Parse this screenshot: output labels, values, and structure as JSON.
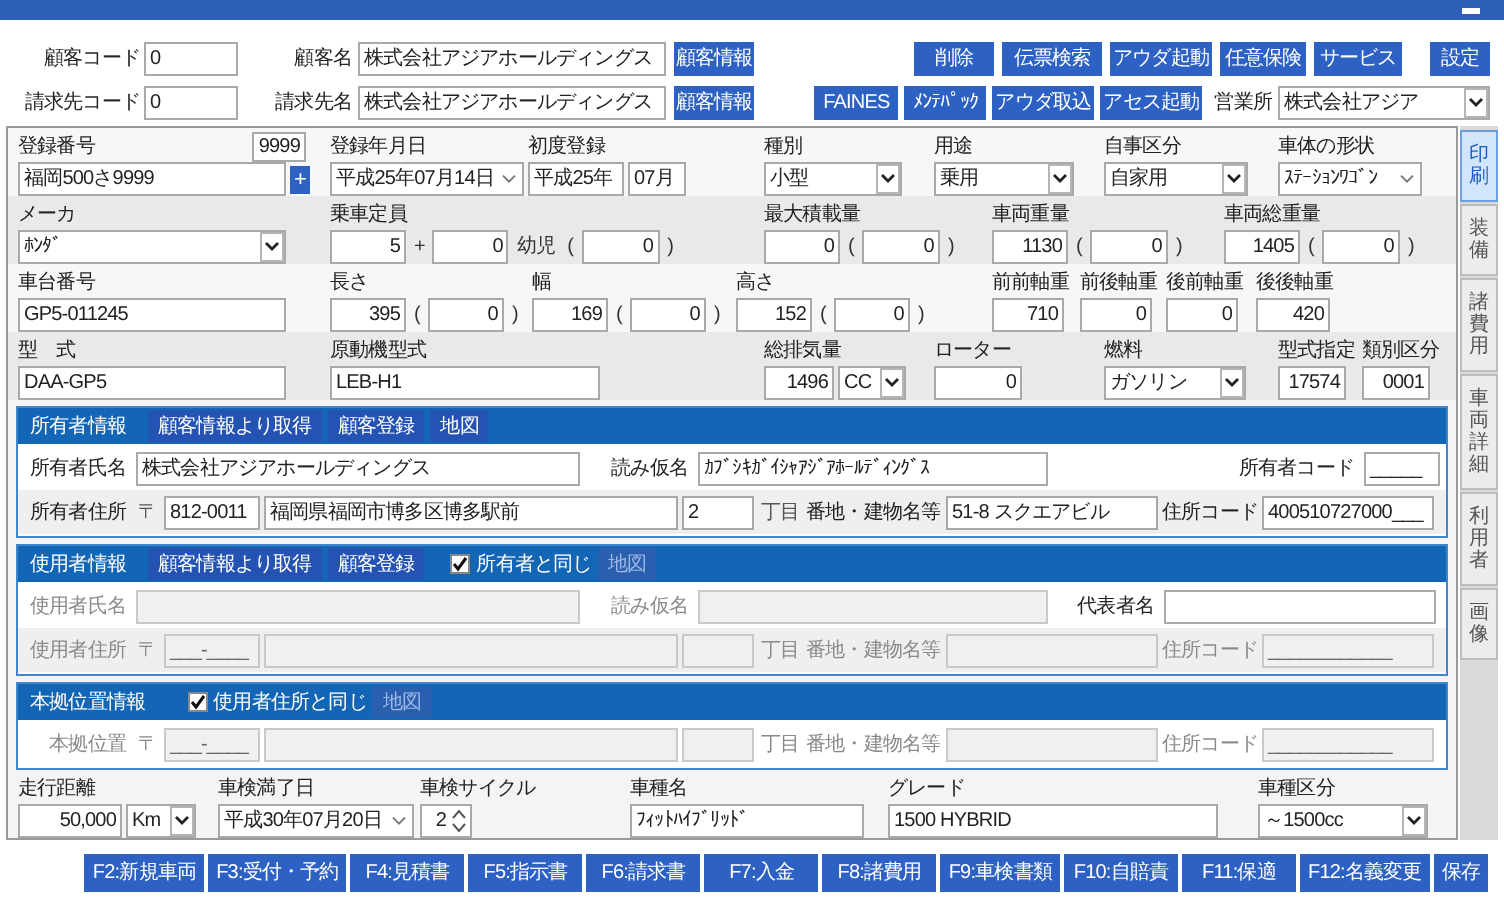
{
  "customer": {
    "rows": [
      {
        "code_label": "顧客コード",
        "code": "0",
        "name_label": "顧客名",
        "name": "株式会社アジアホールディングス",
        "info_button": "顧客情報"
      },
      {
        "code_label": "請求先コード",
        "code": "0",
        "name_label": "請求先名",
        "name": "株式会社アジアホールディングス",
        "info_button": "顧客情報"
      }
    ]
  },
  "toolbar": {
    "row1": [
      "削除",
      "伝票検索",
      "アウダ起動",
      "任意保険",
      "サービス",
      "設定"
    ],
    "row2": [
      "FAINES",
      "ﾒﾝﾃﾊﾟｯｸ",
      "アウダ取込",
      "アセス起動"
    ],
    "office_label": "営業所",
    "office": "株式会社アジア"
  },
  "vehicle": {
    "rows": [
      {
        "fields": [
          {
            "label": "登録番号",
            "number": "9999",
            "controls": [
              {
                "kind": "input",
                "value": "福岡500さ9999"
              },
              {
                "kind": "add_button",
                "value": "+"
              }
            ]
          },
          {
            "label": "登録年月日",
            "controls": [
              {
                "kind": "picker",
                "value": "平成25年07月14日"
              }
            ]
          },
          {
            "label": "初度登録",
            "controls": [
              {
                "kind": "input",
                "value": "平成25年"
              },
              {
                "kind": "input",
                "value": "07月"
              }
            ]
          },
          {
            "label": "種別",
            "controls": [
              {
                "kind": "select",
                "value": "小型"
              }
            ]
          },
          {
            "label": "用途",
            "controls": [
              {
                "kind": "select",
                "value": "乗用"
              }
            ]
          },
          {
            "label": "自事区分",
            "controls": [
              {
                "kind": "select",
                "value": "自家用"
              }
            ]
          },
          {
            "label": "車体の形状",
            "controls": [
              {
                "kind": "picker",
                "value": "ｽﾃｰｼｮﾝﾜｺﾞﾝ"
              }
            ]
          }
        ]
      },
      {
        "fields": [
          {
            "label": "メーカ",
            "controls": [
              {
                "kind": "select",
                "value": "ﾎﾝﾀﾞ"
              }
            ]
          },
          {
            "label": "乗車定員",
            "controls": [
              {
                "kind": "number",
                "value": "5"
              },
              {
                "kind": "text",
                "value": "+"
              },
              {
                "kind": "number",
                "value": "0"
              },
              {
                "kind": "text",
                "value": "幼児"
              },
              {
                "kind": "text",
                "value": "("
              },
              {
                "kind": "number",
                "value": "0"
              },
              {
                "kind": "text",
                "value": ")"
              }
            ]
          },
          {
            "label": "最大積載量",
            "controls": [
              {
                "kind": "number",
                "value": "0"
              },
              {
                "kind": "text",
                "value": "("
              },
              {
                "kind": "number",
                "value": "0"
              },
              {
                "kind": "text",
                "value": ")"
              }
            ]
          },
          {
            "label": "車両重量",
            "controls": [
              {
                "kind": "number",
                "value": "1130"
              },
              {
                "kind": "text",
                "value": "("
              },
              {
                "kind": "number",
                "value": "0"
              },
              {
                "kind": "text",
                "value": ")"
              }
            ]
          },
          {
            "label": "車両総重量",
            "controls": [
              {
                "kind": "number",
                "value": "1405"
              },
              {
                "kind": "text",
                "value": "("
              },
              {
                "kind": "number",
                "value": "0"
              },
              {
                "kind": "text",
                "value": ")"
              }
            ]
          }
        ]
      },
      {
        "fields": [
          {
            "label": "車台番号",
            "controls": [
              {
                "kind": "input",
                "value": "GP5-011245"
              }
            ]
          },
          {
            "label": "長さ",
            "controls": [
              {
                "kind": "number",
                "value": "395"
              },
              {
                "kind": "text",
                "value": "("
              },
              {
                "kind": "number",
                "value": "0"
              },
              {
                "kind": "text",
                "value": ")"
              }
            ]
          },
          {
            "label": "幅",
            "controls": [
              {
                "kind": "number",
                "value": "169"
              },
              {
                "kind": "text",
                "value": "("
              },
              {
                "kind": "number",
                "value": "0"
              },
              {
                "kind": "text",
                "value": ")"
              }
            ]
          },
          {
            "label": "高さ",
            "controls": [
              {
                "kind": "number",
                "value": "152"
              },
              {
                "kind": "text",
                "value": "("
              },
              {
                "kind": "number",
                "value": "0"
              },
              {
                "kind": "text",
                "value": ")"
              }
            ]
          },
          {
            "label": "前前軸重",
            "controls": [
              {
                "kind": "number",
                "value": "710"
              }
            ]
          },
          {
            "label": "前後軸重",
            "controls": [
              {
                "kind": "number",
                "value": "0"
              }
            ]
          },
          {
            "label": "後前軸重",
            "controls": [
              {
                "kind": "number",
                "value": "0"
              }
            ]
          },
          {
            "label": "後後軸重",
            "controls": [
              {
                "kind": "number",
                "value": "420"
              }
            ]
          }
        ]
      },
      {
        "fields": [
          {
            "label": "型　式",
            "controls": [
              {
                "kind": "input",
                "value": "DAA-GP5"
              }
            ]
          },
          {
            "label": "原動機型式",
            "controls": [
              {
                "kind": "input",
                "value": "LEB-H1"
              }
            ]
          },
          {
            "label": "総排気量",
            "controls": [
              {
                "kind": "number",
                "value": "1496"
              },
              {
                "kind": "select",
                "value": "CC"
              }
            ]
          },
          {
            "label": "ローター",
            "controls": [
              {
                "kind": "number",
                "value": "0"
              }
            ]
          },
          {
            "label": "燃料",
            "controls": [
              {
                "kind": "select",
                "value": "ガソリン"
              }
            ]
          },
          {
            "label": "型式指定",
            "controls": [
              {
                "kind": "number",
                "value": "17574"
              }
            ]
          },
          {
            "label": "類別区分",
            "controls": [
              {
                "kind": "number",
                "value": "0001"
              }
            ]
          }
        ]
      }
    ]
  },
  "panels": [
    {
      "title": "所有者情報",
      "header": [
        {
          "kind": "button",
          "label": "顧客情報より取得",
          "disabled": false
        },
        {
          "kind": "button",
          "label": "顧客登録",
          "disabled": false
        },
        {
          "kind": "button",
          "label": "地図",
          "disabled": false
        }
      ],
      "rows": [
        {
          "fields": [
            {
              "kind": "label",
              "value": "所有者氏名",
              "disabled": false
            },
            {
              "kind": "input",
              "value": "株式会社アジアホールディングス",
              "disabled": false
            },
            {
              "kind": "label",
              "value": "読み仮名",
              "disabled": false
            },
            {
              "kind": "input",
              "value": "ｶﾌﾞｼｷｶﾞｲｼｬｱｼﾞｱﾎｰﾙﾃﾞｨﾝｸﾞｽ",
              "disabled": false
            },
            {
              "kind": "label",
              "value": "所有者コード",
              "disabled": false
            },
            {
              "kind": "input",
              "value": "_____",
              "disabled": false
            }
          ]
        },
        {
          "fields": [
            {
              "kind": "label",
              "value": "所有者住所",
              "disabled": false
            },
            {
              "kind": "mark",
              "value": "〒",
              "disabled": false
            },
            {
              "kind": "input",
              "value": "812-0011",
              "disabled": false
            },
            {
              "kind": "input",
              "value": "福岡県福岡市博多区博多駅前",
              "disabled": false
            },
            {
              "kind": "input",
              "value": "2",
              "disabled": false
            },
            {
              "kind": "mark",
              "value": "丁目",
              "disabled": false
            },
            {
              "kind": "label",
              "value": "番地・建物名等",
              "disabled": false
            },
            {
              "kind": "input",
              "value": "51-8 スクエアビル",
              "disabled": false
            },
            {
              "kind": "label",
              "value": "住所コード",
              "disabled": false
            },
            {
              "kind": "input",
              "value": "400510727000___",
              "disabled": false
            }
          ]
        }
      ]
    },
    {
      "title": "使用者情報",
      "header": [
        {
          "kind": "button",
          "label": "顧客情報より取得",
          "disabled": false
        },
        {
          "kind": "button",
          "label": "顧客登録",
          "disabled": false
        },
        {
          "kind": "checkbox",
          "label": "所有者と同じ",
          "checked": true
        },
        {
          "kind": "button",
          "label": "地図",
          "disabled": true
        }
      ],
      "rows": [
        {
          "fields": [
            {
              "kind": "label",
              "value": "使用者氏名",
              "disabled": true
            },
            {
              "kind": "input",
              "disabled": true
            },
            {
              "kind": "label",
              "value": "読み仮名",
              "disabled": true
            },
            {
              "kind": "input",
              "disabled": true
            },
            {
              "kind": "label",
              "value": "代表者名",
              "disabled": false
            },
            {
              "kind": "input",
              "disabled": false
            }
          ]
        },
        {
          "fields": [
            {
              "kind": "label",
              "value": "使用者住所",
              "disabled": true
            },
            {
              "kind": "mark",
              "value": "〒",
              "disabled": true
            },
            {
              "kind": "input",
              "value": "___-____",
              "disabled": true
            },
            {
              "kind": "input",
              "disabled": true
            },
            {
              "kind": "input",
              "disabled": true
            },
            {
              "kind": "mark",
              "value": "丁目",
              "disabled": true
            },
            {
              "kind": "label",
              "value": "番地・建物名等",
              "disabled": true
            },
            {
              "kind": "input",
              "disabled": true
            },
            {
              "kind": "label",
              "value": "住所コード",
              "disabled": true
            },
            {
              "kind": "input",
              "value": "____________",
              "disabled": true
            }
          ]
        }
      ]
    },
    {
      "title": "本拠位置情報",
      "header": [
        {
          "kind": "checkbox",
          "label": "使用者住所と同じ",
          "checked": true
        },
        {
          "kind": "button",
          "label": "地図",
          "disabled": true
        }
      ],
      "rows": [
        {
          "fields": [
            {
              "kind": "label",
              "value": "本拠位置",
              "disabled": true
            },
            {
              "kind": "mark",
              "value": "〒",
              "disabled": true
            },
            {
              "kind": "input",
              "value": "___-____",
              "disabled": true
            },
            {
              "kind": "input",
              "disabled": true
            },
            {
              "kind": "input",
              "disabled": true
            },
            {
              "kind": "mark",
              "value": "丁目",
              "disabled": true
            },
            {
              "kind": "label",
              "value": "番地・建物名等",
              "disabled": true
            },
            {
              "kind": "input",
              "disabled": true
            },
            {
              "kind": "label",
              "value": "住所コード",
              "disabled": true
            },
            {
              "kind": "input",
              "value": "____________",
              "disabled": true
            }
          ]
        }
      ]
    }
  ],
  "inspection": [
    {
      "label": "走行距離",
      "controls": [
        {
          "kind": "number",
          "value": "50,000"
        },
        {
          "kind": "select",
          "value": "Km"
        }
      ]
    },
    {
      "label": "車検満了日",
      "controls": [
        {
          "kind": "picker",
          "value": "平成30年07月20日"
        }
      ]
    },
    {
      "label": "車検サイクル",
      "controls": [
        {
          "kind": "spinner",
          "value": "2"
        }
      ]
    },
    {
      "label": "車種名",
      "controls": [
        {
          "kind": "input",
          "value": "ﾌｨｯﾄﾊｲﾌﾞﾘｯﾄﾞ"
        }
      ]
    },
    {
      "label": "グレード",
      "controls": [
        {
          "kind": "input",
          "value": "1500 HYBRID"
        }
      ]
    },
    {
      "label": "車種区分",
      "controls": [
        {
          "kind": "select",
          "value": "～1500cc"
        }
      ]
    }
  ],
  "side_tabs": [
    {
      "label": "印刷",
      "selected": true
    },
    {
      "label": "装備",
      "selected": false
    },
    {
      "label": "諸費用",
      "selected": false
    },
    {
      "label": "車両詳細",
      "selected": false
    },
    {
      "label": "利用者",
      "selected": false
    },
    {
      "label": "画像",
      "selected": false
    }
  ],
  "function_keys": [
    "F2:新規車両",
    "F3:受付・予約",
    "F4:見積書",
    "F5:指示書",
    "F6:請求書",
    "F7:入金",
    "F8:諸費用",
    "F9:車検書類",
    "F10:自賠責",
    "F11:保適",
    "F12:名義変更",
    "保存"
  ]
}
